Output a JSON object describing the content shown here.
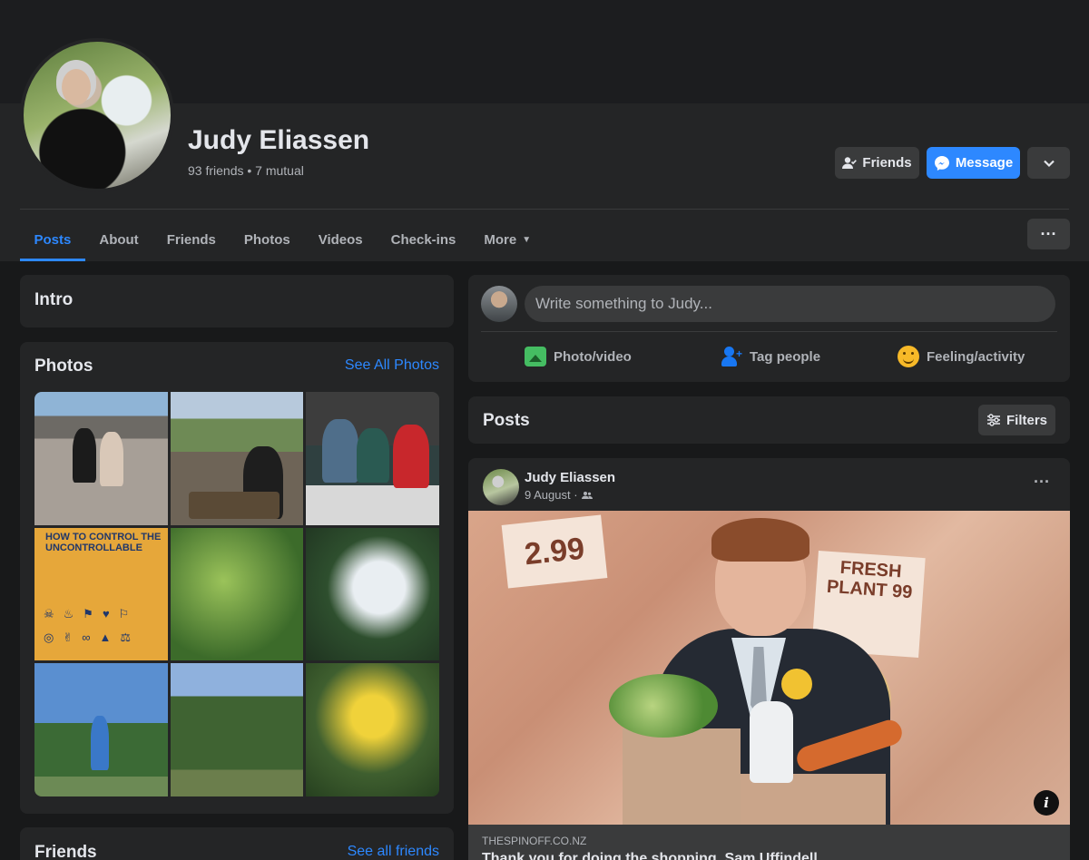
{
  "profile": {
    "name": "Judy Eliassen",
    "subtitle": "93 friends • 7 mutual",
    "friends_button": "Friends",
    "message_button": "Message"
  },
  "tabs": [
    {
      "label": "Posts",
      "active": true
    },
    {
      "label": "About"
    },
    {
      "label": "Friends"
    },
    {
      "label": "Photos"
    },
    {
      "label": "Videos"
    },
    {
      "label": "Check-ins"
    },
    {
      "label": "More"
    }
  ],
  "intro": {
    "title": "Intro"
  },
  "photos": {
    "title": "Photos",
    "see_all": "See All Photos",
    "book_title": "HOW TO CONTROL THE UNCONTROLLABLE"
  },
  "friends_section": {
    "title": "Friends",
    "see_all": "See all friends"
  },
  "composer": {
    "placeholder": "Write something to Judy...",
    "actions": [
      "Photo/video",
      "Tag people",
      "Feeling/activity"
    ]
  },
  "posts_header": {
    "title": "Posts",
    "filters": "Filters"
  },
  "post": {
    "author": "Judy Eliassen",
    "date": "9 August ·",
    "image_price1": "2.99",
    "image_sign": "FRESH PLANT 99",
    "source_domain": "THESPINOFF.CO.NZ",
    "headline": "Thank you for doing the shopping, Sam Uffindell"
  },
  "colors": {
    "background": "#18191a",
    "card": "#242526",
    "accent": "#2d88ff",
    "text": "#e4e6eb",
    "secondary_text": "#b0b3b8"
  }
}
